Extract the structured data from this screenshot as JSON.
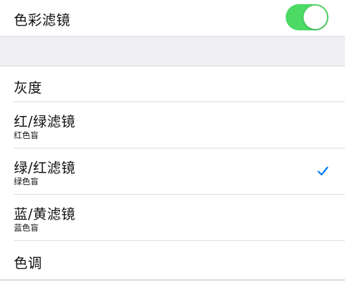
{
  "color_filters": {
    "label": "色彩滤镜",
    "enabled": true,
    "accent_color": "#4cd964"
  },
  "filters": [
    {
      "title": "灰度",
      "subtitle": "",
      "selected": false
    },
    {
      "title": "红/绿滤镜",
      "subtitle": "红色盲",
      "selected": false
    },
    {
      "title": "绿/红滤镜",
      "subtitle": "绿色盲",
      "selected": true
    },
    {
      "title": "蓝/黄滤镜",
      "subtitle": "蓝色盲",
      "selected": false
    },
    {
      "title": "色调",
      "subtitle": "",
      "selected": false
    }
  ],
  "check_color": "#007aff",
  "icons": {
    "check": "checkmark-icon",
    "toggle": "toggle-switch"
  }
}
